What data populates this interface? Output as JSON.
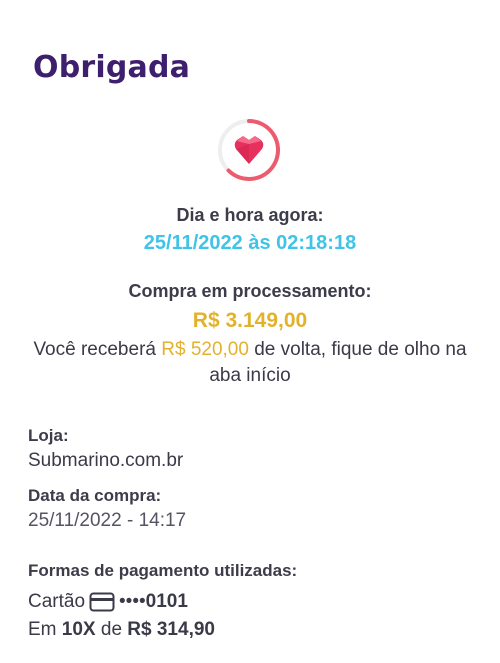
{
  "header": {
    "title": "Obrigada"
  },
  "status": {
    "datetime_label": "Dia e hora agora:",
    "datetime_value": "25/11/2022 às 02:18:18",
    "purchase_label": "Compra em processamento:",
    "purchase_amount": "R$ 3.149,00",
    "cashback_prefix": "Você receberá ",
    "cashback_amount": "R$ 520,00",
    "cashback_suffix": " de volta, fique de olho na aba início"
  },
  "details": {
    "store_label": "Loja:",
    "store_value": "Submarino.com.br",
    "date_label": "Data da compra:",
    "date_value": "25/11/2022 - 14:17",
    "payment_label": "Formas de pagamento utilizadas:",
    "payment_method": "Cartão",
    "card_masked": "••••",
    "card_last4": "0101",
    "installments_prefix": "Em ",
    "installments_count": "10X",
    "installments_middle": " de ",
    "installments_value": "R$ 314,90"
  },
  "colors": {
    "title": "#3d1f6e",
    "accent_blue": "#3fc3e8",
    "accent_gold": "#e3b22c",
    "heart": "#e8305e",
    "ring": "#ec5c6f"
  },
  "icons": {
    "badge": "heart-gem-icon",
    "card": "credit-card-icon"
  }
}
